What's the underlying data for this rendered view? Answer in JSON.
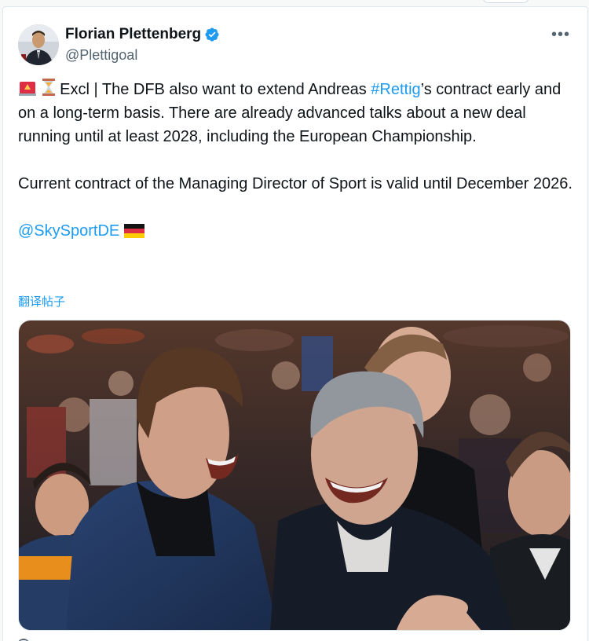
{
  "author": {
    "name": "Florian Plettenberg",
    "handle": "@Plettigoal",
    "verified": true
  },
  "tweet": {
    "emojis": [
      "rotating-light",
      "hourglass"
    ],
    "line1_prefix": "Excl | The DFB also want to extend Andreas ",
    "hashtag": "#Rettig",
    "line1_suffix": "’s contract early and on a long-term basis. There are already advanced talks about a new deal running until at least 2028, including the European Championship.",
    "paragraph2": "Current contract of the Managing Director of Sport is valid until December 2026.",
    "mention": "@SkySportDE",
    "flag": "germany-flag"
  },
  "translate_label": "翻译帖子",
  "media": {
    "type": "photo",
    "description_icon": "photo"
  },
  "colors": {
    "link": "#1d9bf0",
    "text": "#0f1419",
    "secondary": "#536471",
    "verified": "#1d9bf0"
  }
}
